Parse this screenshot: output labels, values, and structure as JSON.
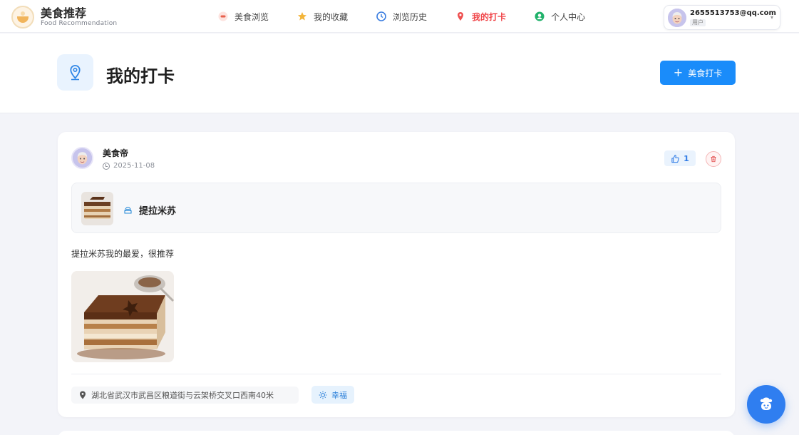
{
  "brand": {
    "title": "美食推荐",
    "subtitle": "Food Recommendation",
    "logo_icon": "food-bowl-logo"
  },
  "nav": {
    "items": [
      {
        "label": "美食浏览",
        "icon": "food-plate-icon",
        "active": false
      },
      {
        "label": "我的收藏",
        "icon": "star-icon",
        "active": false
      },
      {
        "label": "浏览历史",
        "icon": "clock-icon",
        "active": false
      },
      {
        "label": "我的打卡",
        "icon": "location-pin-icon",
        "active": true
      },
      {
        "label": "个人中心",
        "icon": "person-icon",
        "active": false
      }
    ]
  },
  "user": {
    "email": "2655513753@qq.com",
    "role": "用户"
  },
  "page": {
    "title": "我的打卡",
    "add_button": "美食打卡"
  },
  "post": {
    "author": "美食帝",
    "date": "2025-11-08",
    "likes": "1",
    "food_name": "提拉米苏",
    "text": "提拉米苏我的最爱，很推荐",
    "location": "湖北省武汉市武昌区粮道街与云架桥交叉口西南40米",
    "mood": "幸福"
  },
  "colors": {
    "primary": "#1a8cfa",
    "active_nav": "#f0464a",
    "background": "#f3f4f9"
  }
}
